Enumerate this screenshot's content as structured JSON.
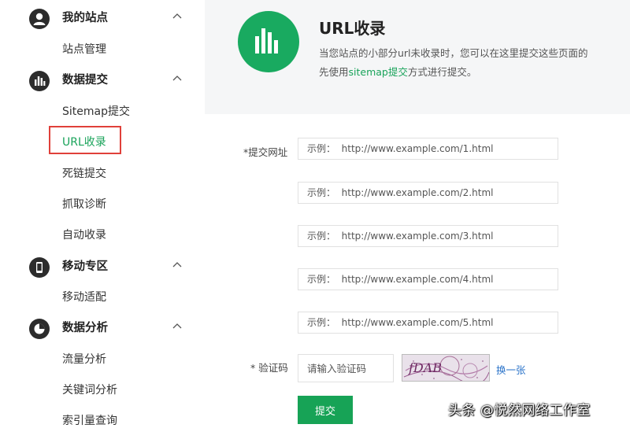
{
  "sidebar": {
    "sections": [
      {
        "title": "我的站点",
        "icon": "user-icon",
        "items": [
          "站点管理"
        ]
      },
      {
        "title": "数据提交",
        "icon": "bar-chart-icon",
        "items": [
          "Sitemap提交",
          "URL收录",
          "死链提交",
          "抓取诊断",
          "自动收录"
        ]
      },
      {
        "title": "移动专区",
        "icon": "mobile-icon",
        "items": [
          "移动适配"
        ]
      },
      {
        "title": "数据分析",
        "icon": "pie-chart-icon",
        "items": [
          "流量分析",
          "关键词分析",
          "索引量查询"
        ]
      }
    ],
    "active_item": "URL收录",
    "highlight_color": "#e0403a",
    "active_color": "#19a35a"
  },
  "header": {
    "logo_icon": "bar-chart-icon",
    "title": "URL收录",
    "desc_line1": "当您站点的小部分url未收录时，您可以在这里提交这些页面的",
    "desc_line2_prefix": "先使用",
    "desc_line2_link": "sitemap提交",
    "desc_line2_suffix": "方式进行提交。"
  },
  "form": {
    "url_label": "*提交网址",
    "url_placeholders": [
      "示例：  http://www.example.com/1.html",
      "示例：  http://www.example.com/2.html",
      "示例：  http://www.example.com/3.html",
      "示例：  http://www.example.com/4.html",
      "示例：  http://www.example.com/5.html"
    ],
    "captcha_label": "* 验证码",
    "captcha_placeholder": "请输入验证码",
    "captcha_image_text": "fDAB",
    "refresh_label": "换一张",
    "submit_label": "提交"
  },
  "watermark": "头条 @悦然网络工作室",
  "colors": {
    "brand_green": "#17a356",
    "link_blue": "#2a73c9"
  }
}
